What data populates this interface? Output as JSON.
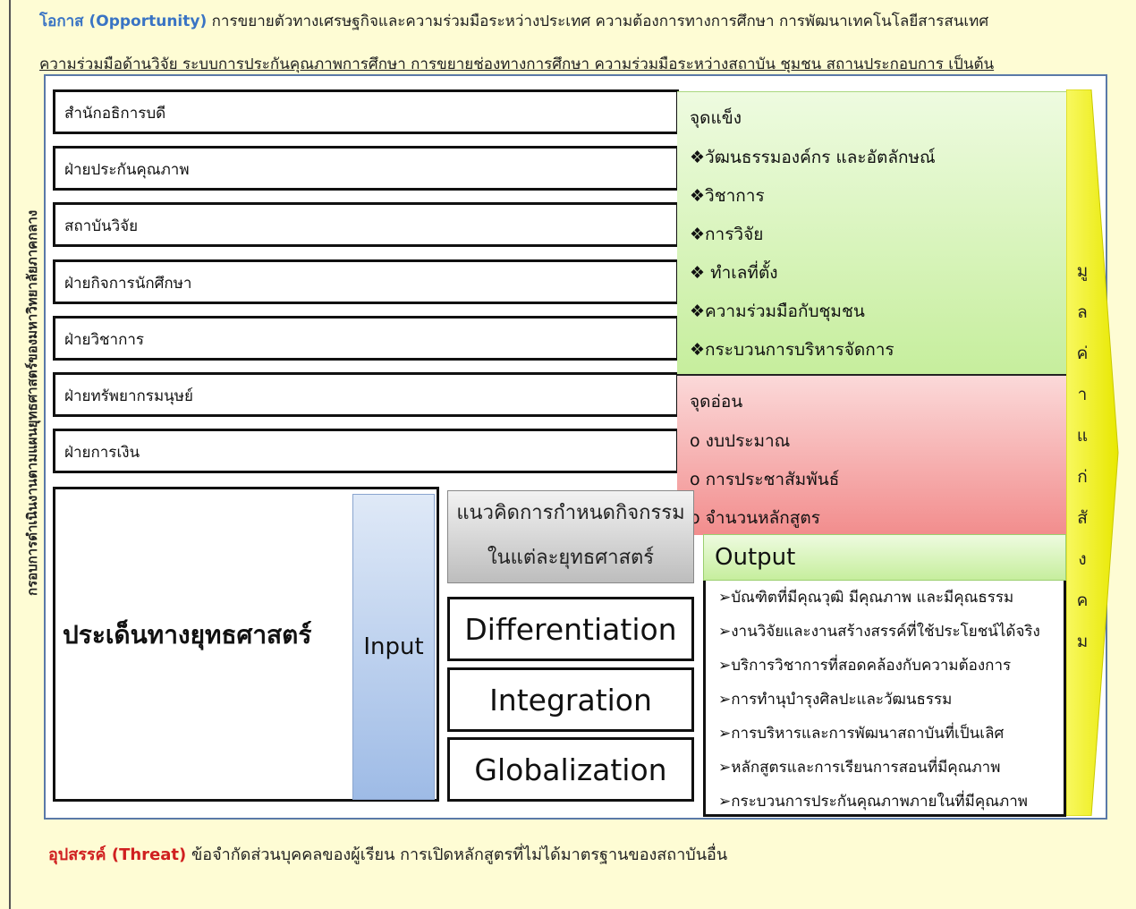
{
  "opportunity": {
    "label": "โอกาส (Opportunity)",
    "line1": "การขยายตัวทางเศรษฐกิจและความร่วมมือระหว่างประเทศ ความต้องการทางการศึกษา การพัฒนาเทคโนโลยีสารสนเทศ",
    "line2": "ความร่วมมือด้านวิจัย ระบบการประกันคุณภาพการศึกษา การขยายช่องทางการศึกษา ความร่วมมือระหว่างสถาบัน ชุมชน สถานประกอบการ เป็นต้น"
  },
  "vertical_label": "กรอบการดำเนินงานตามแผนยุทธศาสตร์ของมหาวิทยาลัยภาคกลาง",
  "units": [
    "สำนักอธิการบดี",
    "ฝ่ายประกันคุณภาพ",
    "สถาบันวิจัย",
    "ฝ่ายกิจการนักศึกษา",
    "ฝ่ายวิชาการ",
    "ฝ่ายทรัพยากรมนุษย์",
    "ฝ่ายการเงิน"
  ],
  "strengths": {
    "title": "จุดแข็ง",
    "bullet": "❖",
    "items": [
      "วัฒนธรรมองค์กร และอัตลักษณ์",
      "วิชาการ",
      "การวิจัย",
      " ทำเลที่ตั้ง",
      "ความร่วมมือกับชุมชน",
      "กระบวนการบริหารจัดการ"
    ]
  },
  "weaknesses": {
    "title": "จุดอ่อน",
    "bullet": "o",
    "items": [
      "งบประมาณ",
      "การประชาสัมพันธ์",
      "จำนวนหลักสูตร"
    ]
  },
  "strategic_issues": "ประเด็นทางยุทธศาสตร์",
  "input_label": "Input",
  "activity_concept": {
    "line1": "แนวคิดการกำหนดกิจกรรม",
    "line2": "ในแต่ละยุทธศาสตร์"
  },
  "strategies": [
    "Differentiation",
    "Integration",
    "Globalization"
  ],
  "output": {
    "title": "Output",
    "bullet": "➢",
    "items": [
      "บัณฑิตที่มีคุณวุฒิ มีคุณภาพ และมีคุณธรรม",
      "งานวิจัยและงานสร้างสรรค์ที่ใช้ประโยชน์ได้จริง",
      "บริการวิชาการที่สอดคล้องกับความต้องการ",
      "การทำนุบำรุงศิลปะและวัฒนธรรม",
      "การบริหารและการพัฒนาสถาบันที่เป็นเลิศ",
      "หลักสูตรและการเรียนการสอนที่มีคุณภาพ",
      "กระบวนการประกันคุณภาพภายในที่มีคุณภาพ"
    ]
  },
  "social_value": [
    "มู",
    "ล",
    "ค่",
    "า",
    "แ",
    "ก่",
    "สั",
    "ง",
    "ค",
    "ม"
  ],
  "threat": {
    "label": "อุปสรรค์ (Threat)",
    "text": "ข้อจำกัดส่วนบุคคลของผู้เรียน การเปิดหลักสูตรที่ไม่ได้มาตรฐานของสถาบันอื่น"
  },
  "colors": {
    "background": "#fefcd4",
    "opportunity_label": "#3a74c4",
    "threat_label": "#d02020",
    "strength_fill": "#c6ee9d",
    "weakness_fill": "#f28d8d",
    "input_fill": "#9ebbe6",
    "value_arrow": "#f2f20a"
  }
}
